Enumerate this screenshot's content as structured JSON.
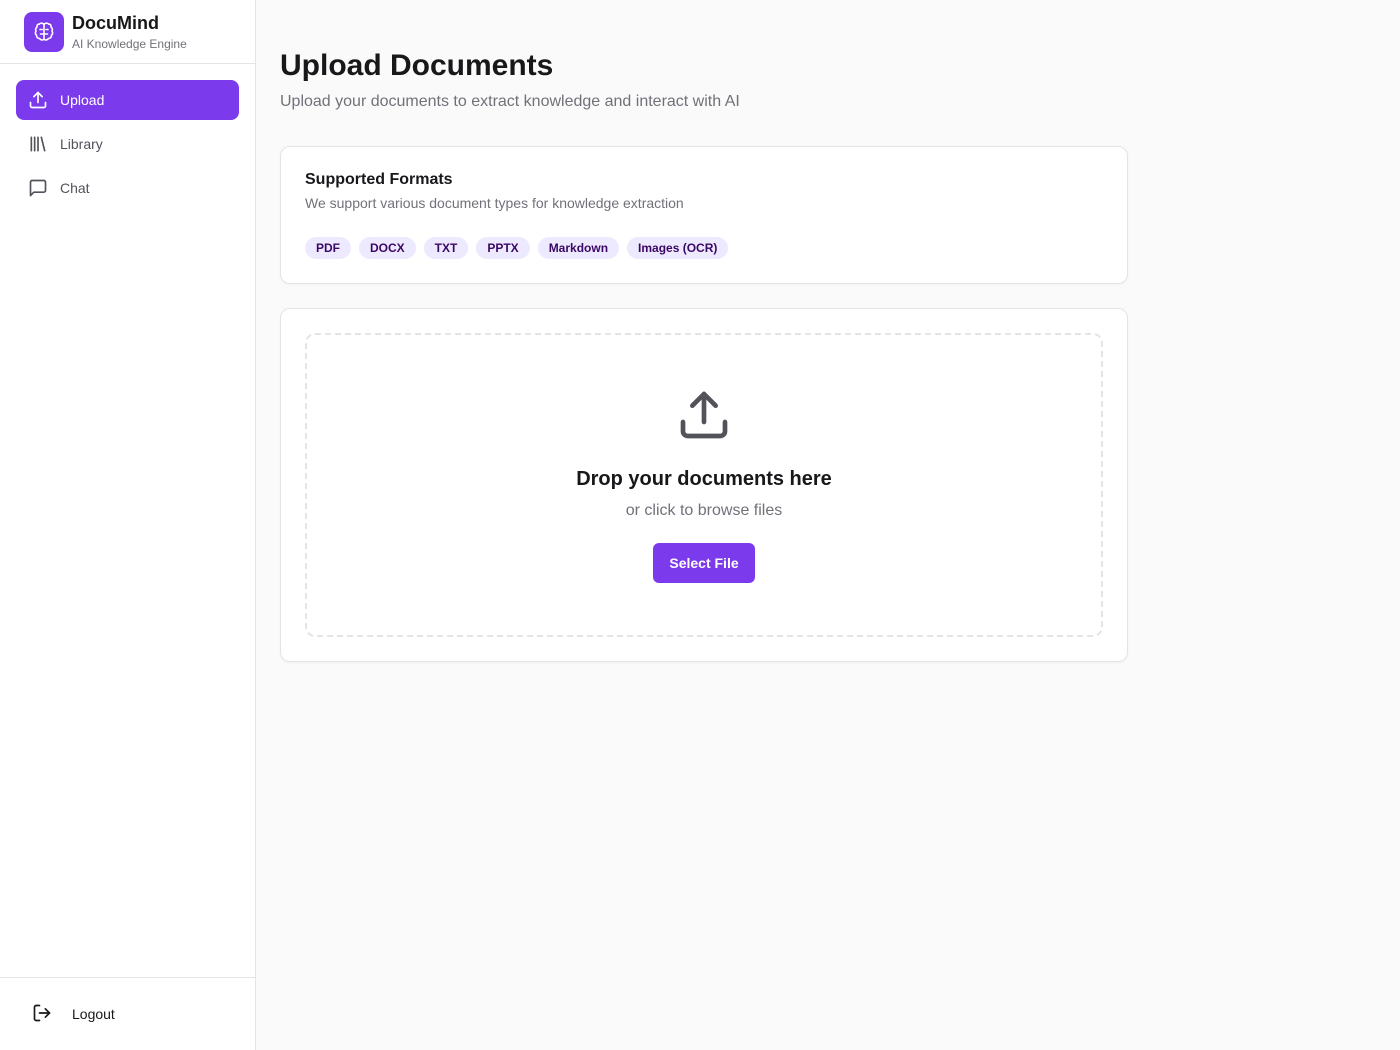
{
  "brand": {
    "name": "DocuMind",
    "subtitle": "AI Knowledge Engine",
    "logo_icon": "brain-icon",
    "accent": "#7c3aed"
  },
  "nav": {
    "items": [
      {
        "label": "Upload",
        "icon": "upload-icon",
        "active": true
      },
      {
        "label": "Library",
        "icon": "library-icon",
        "active": false
      },
      {
        "label": "Chat",
        "icon": "chat-icon",
        "active": false
      }
    ]
  },
  "footer": {
    "logout_label": "Logout",
    "logout_icon": "logout-icon"
  },
  "page": {
    "title": "Upload Documents",
    "subtitle": "Upload your documents to extract knowledge and interact with AI"
  },
  "formats": {
    "title": "Supported Formats",
    "description": "We support various document types for knowledge extraction",
    "types": [
      "PDF",
      "DOCX",
      "TXT",
      "PPTX",
      "Markdown",
      "Images (OCR)"
    ]
  },
  "dropzone": {
    "icon": "upload-icon",
    "title": "Drop your documents here",
    "subtitle": "or click to browse files",
    "button_label": "Select File"
  }
}
